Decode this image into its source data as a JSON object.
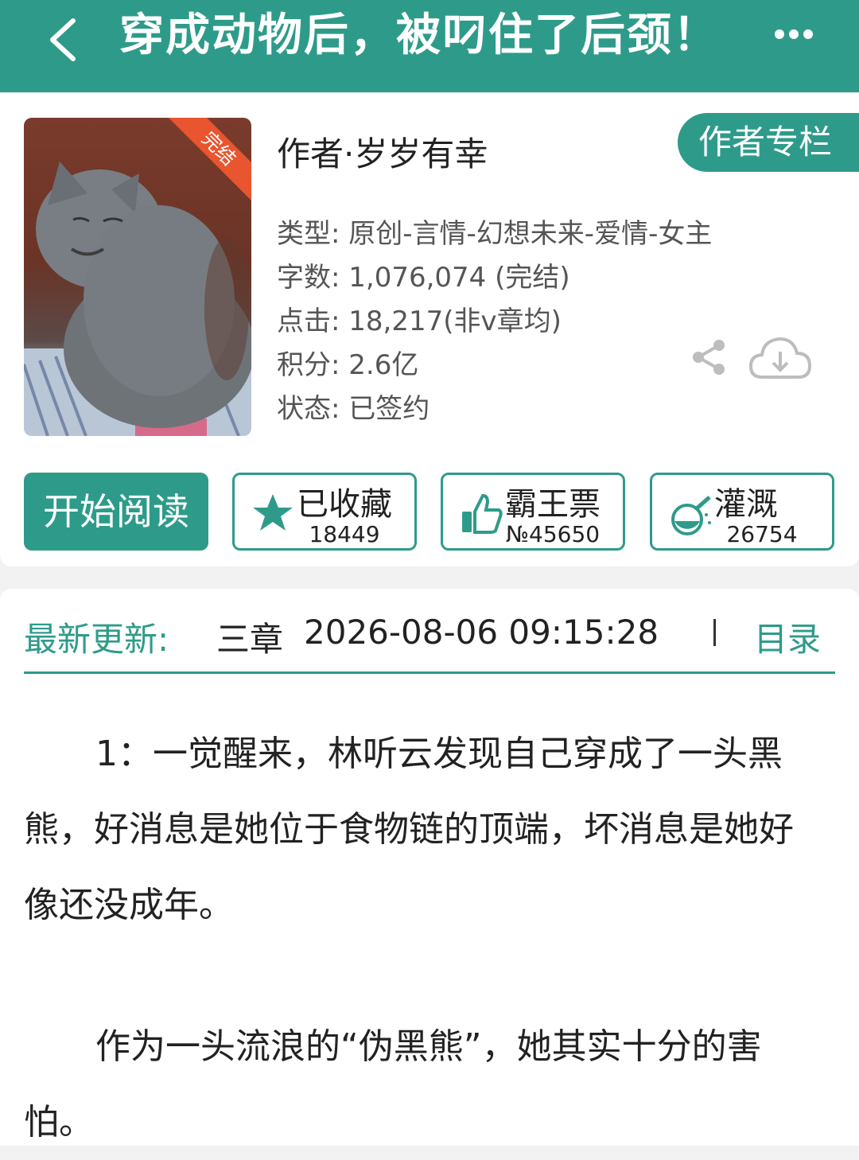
{
  "header": {
    "title": "穿成动物后，被叼住了后颈！",
    "back_icon": "chevron-left-icon",
    "more_icon": "more-dots-icon"
  },
  "book": {
    "cover_badge": "完结",
    "author": "作者·岁岁有幸",
    "author_column": "作者专栏",
    "type": "类型: 原创-言情-幻想未来-爱情-女主",
    "word_count": "字数: 1,076,074 (完结)",
    "clicks": "点击: 18,217(非v章均)",
    "score": "积分: 2.6亿",
    "status": "状态: 已签约"
  },
  "actions": {
    "read": "开始阅读",
    "favorite": {
      "label": "已收藏",
      "count": "18449"
    },
    "vote": {
      "label": "霸王票",
      "count": "№45650"
    },
    "water": {
      "label": "灌溉",
      "count": "26754"
    }
  },
  "update": {
    "label": "最新更新:",
    "chapter": "三章",
    "time": "2026-08-06 09:15:28",
    "toc": "目录"
  },
  "content": {
    "paragraphs": [
      "1：一觉醒来，林听云发现自己穿成了一头黑熊，好消息是她位于食物链的顶端，坏消息是她好像还没成年。",
      "作为一头流浪的“伪黑熊”，她其实十分的害怕。"
    ]
  },
  "colors": {
    "accent": "#2e9b8a",
    "badge": "#e8552e"
  }
}
